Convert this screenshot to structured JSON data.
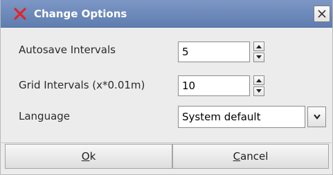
{
  "window": {
    "title": "Change Options",
    "icons": {
      "app": "red-x-icon",
      "close": "close-icon"
    }
  },
  "form": {
    "autosave": {
      "label": "Autosave Intervals",
      "value": "5"
    },
    "grid": {
      "label": "Grid Intervals (x*0.01m)",
      "value": "10"
    },
    "language": {
      "label": "Language",
      "value": "System default"
    }
  },
  "buttons": {
    "ok": {
      "mnemonic": "O",
      "rest": "k"
    },
    "cancel": {
      "mnemonic": "C",
      "rest": "ancel"
    }
  },
  "colors": {
    "titlebar": "#6a86b9",
    "app_icon": "#e0262a",
    "dialog_bg": "#ececec"
  }
}
